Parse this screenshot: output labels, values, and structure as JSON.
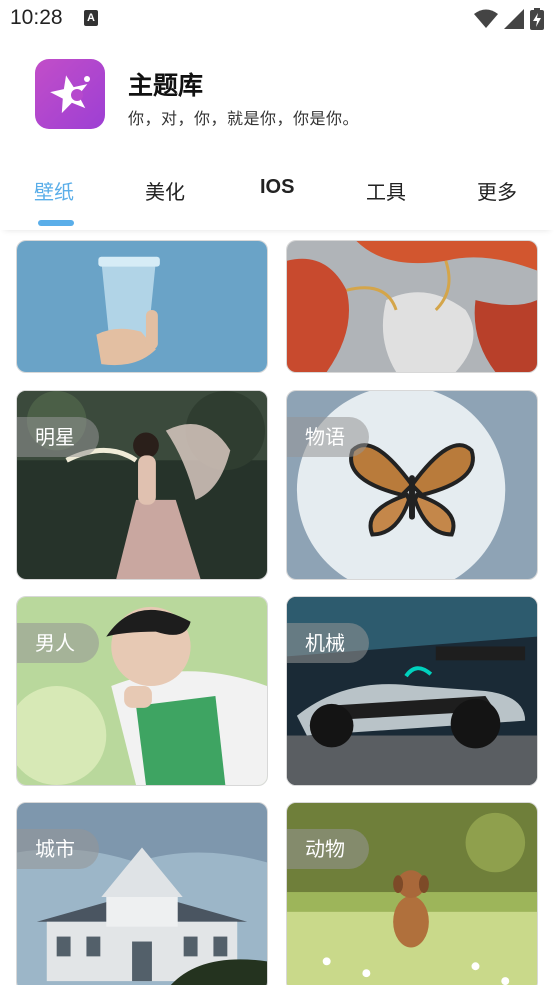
{
  "status_bar": {
    "time": "10:28",
    "notification_icon": "a-icon",
    "icons": [
      "wifi-icon",
      "cell-signal-icon",
      "battery-charging-icon"
    ]
  },
  "header": {
    "app_icon": "star-sparkle-icon",
    "title": "主题库",
    "subtitle": "你，对，你，就是你，你是你。"
  },
  "tabs": [
    {
      "label": "壁纸",
      "active": true
    },
    {
      "label": "美化",
      "active": false
    },
    {
      "label": "IOS",
      "active": false
    },
    {
      "label": "工具",
      "active": false
    },
    {
      "label": "更多",
      "active": false
    }
  ],
  "categories": [
    {
      "label": "",
      "image": "hand holding blue plastic cup"
    },
    {
      "label": "",
      "image": "red and gold marble texture"
    },
    {
      "label": "明星",
      "image": "woman in fairy costume"
    },
    {
      "label": "物语",
      "image": "butterfly on white plate"
    },
    {
      "label": "男人",
      "image": "young man in green jacket"
    },
    {
      "label": "机械",
      "image": "racing car"
    },
    {
      "label": "城市",
      "image": "white house"
    },
    {
      "label": "动物",
      "image": "puppy running on grass"
    }
  ],
  "colors": {
    "accent": "#5aaee9",
    "app_icon": "#b649cd"
  }
}
